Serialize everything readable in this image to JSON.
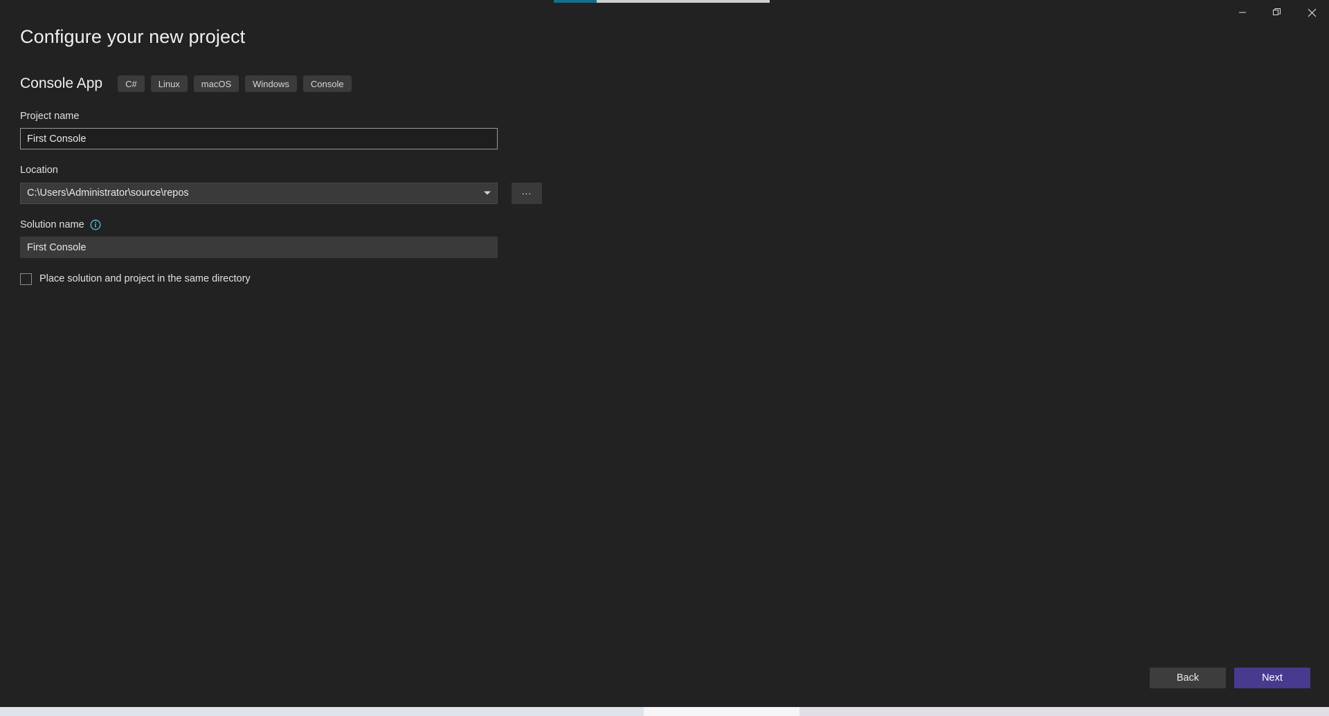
{
  "window": {
    "title": "Configure your new project",
    "progress": {
      "fill_color": "#156f8e",
      "track_color": "#cfcfcf"
    },
    "caption": {
      "minimize_label": "Minimize",
      "restore_label": "Restore",
      "close_label": "Close"
    }
  },
  "template": {
    "name": "Console App",
    "tags": [
      "C#",
      "Linux",
      "macOS",
      "Windows",
      "Console"
    ]
  },
  "form": {
    "project_name": {
      "label": "Project name",
      "value": "First Console",
      "placeholder": ""
    },
    "location": {
      "label": "Location",
      "value": "C:\\Users\\Administrator\\source\\repos",
      "browse_label": "..."
    },
    "solution_name": {
      "label": "Solution name",
      "value": "First Console",
      "info_tooltip": "Solution name"
    },
    "same_directory": {
      "label": "Place solution and project in the same directory",
      "checked": false
    }
  },
  "footer": {
    "back_label": "Back",
    "next_label": "Next",
    "primary_color": "#473a8f"
  }
}
